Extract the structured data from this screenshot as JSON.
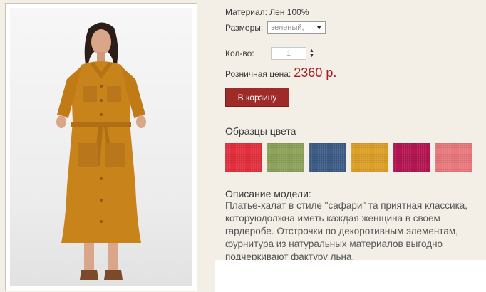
{
  "product": {
    "material": "Материал: Лен 100%",
    "sizes_label": "Размеры:",
    "size_selected": "зеленый,",
    "qty_label": "Кол-во:",
    "qty_value": "1",
    "price_label": "Розничная цена:",
    "price_value": "2360 р.",
    "cart_button": "В корзину"
  },
  "swatches": {
    "title": "Образцы цвета",
    "colors": [
      "#e4303e",
      "#8da25a",
      "#3e5c86",
      "#dca028",
      "#b31650",
      "#e87a7e"
    ]
  },
  "description": {
    "title": "Описание модели:",
    "text": "Платье-халат в стиле \"сафари\" та приятная классика, которуюдолжна иметь каждая женщина в своем гардеробе. Отстрочки по декоротивным элементам, фурнитура из натуральных материалов выгодно подчеркивают фактуру льна."
  }
}
